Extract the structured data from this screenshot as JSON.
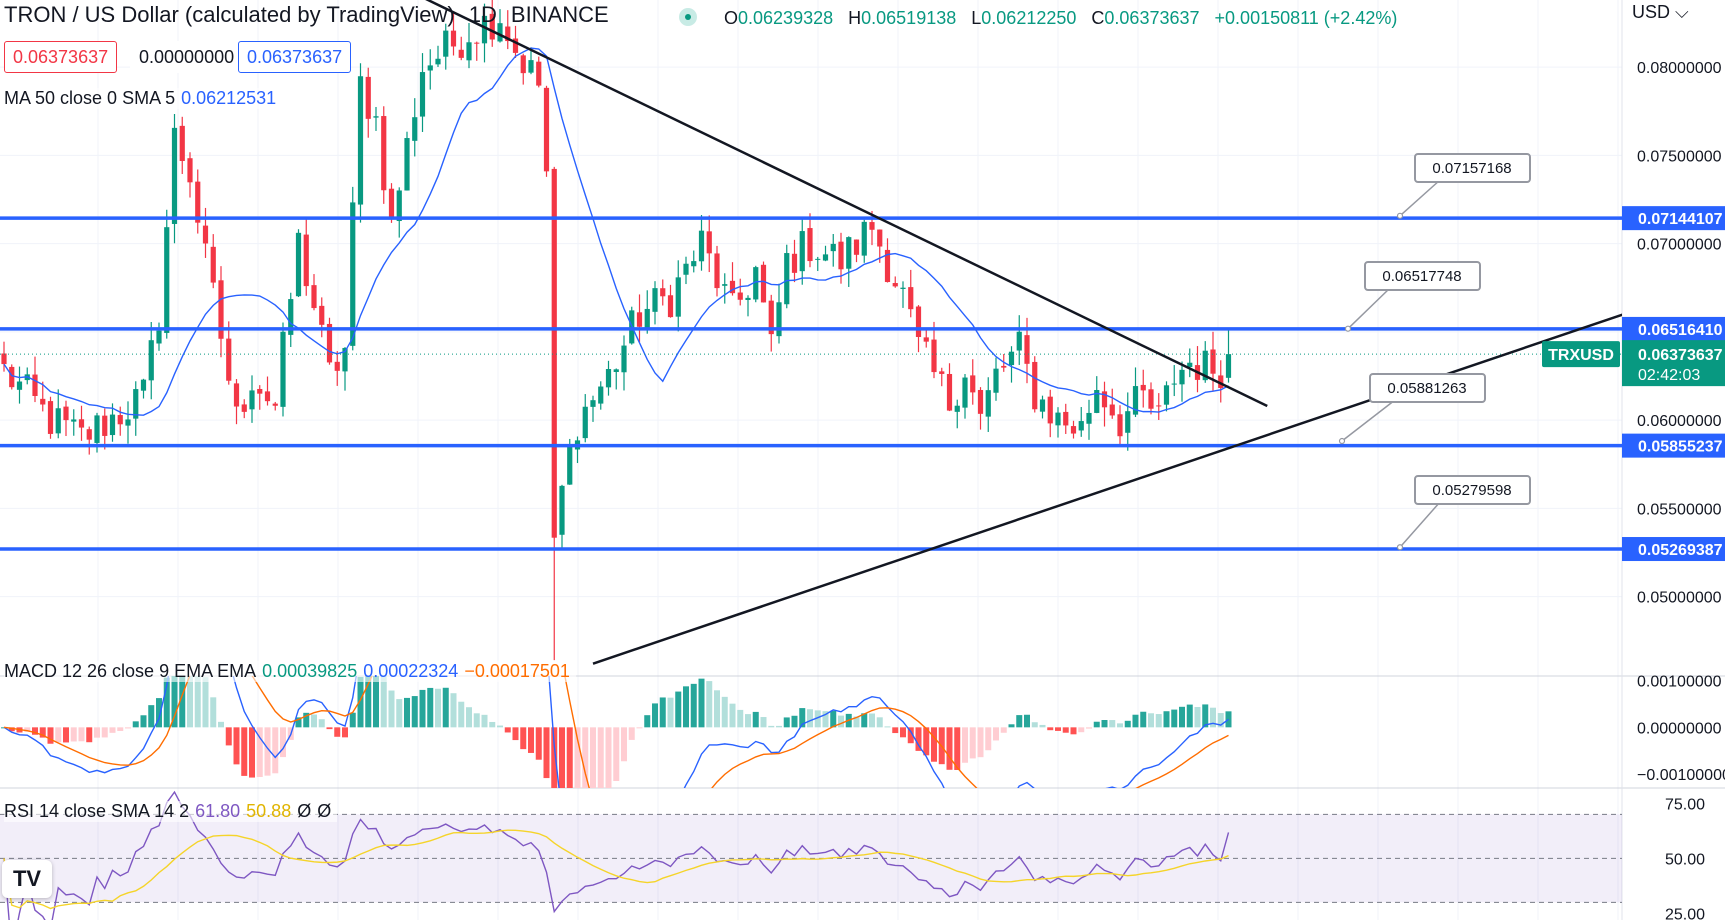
{
  "header": {
    "symbol_title": "TRON / US Dollar (calculated by TradingView)",
    "interval": "1D",
    "exchange": "BINANCE",
    "open_label": "O",
    "open": "0.06239328",
    "high_label": "H",
    "high": "0.06519138",
    "low_label": "L",
    "low": "0.06212250",
    "close_label": "C",
    "close": "0.06373637",
    "change": "+0.00150811 (+2.42%)"
  },
  "quote_boxes": {
    "sell": "0.06373637",
    "spread": "0.00000000",
    "buy": "0.06373637"
  },
  "currency_selector": "USD",
  "logo_text": "TV",
  "colors": {
    "up": "#089981",
    "down": "#f23645",
    "accent": "#2962ff",
    "ma_line": "#2962ff",
    "macd_line": "#2962ff",
    "signal_line": "#ff6d00",
    "rsi_line": "#7e57c2",
    "rsi_sma": "#f5d42a",
    "level_line": "#2962ff"
  },
  "indicators": {
    "ma": {
      "label": "MA 50 close 0 SMA 5",
      "value": "0.06212531"
    },
    "macd": {
      "label": "MACD 12 26 close 9 EMA EMA",
      "hist": "0.00039825",
      "macd": "0.00022324",
      "signal": "−0.00017501"
    },
    "rsi": {
      "label": "RSI 14 close SMA 14 2",
      "rsi": "61.80",
      "sma": "50.88",
      "extra1": "Ø",
      "extra2": "Ø"
    }
  },
  "chart_data": [
    {
      "type": "candlestick",
      "name": "TRXUSD",
      "ylim": [
        0.0455,
        0.0838
      ],
      "y_ticks": [
        "0.08000000",
        "0.07500000",
        "0.07000000",
        "0.06500000",
        "0.06000000",
        "0.05500000",
        "0.05000000"
      ],
      "y_tick_values": [
        0.08,
        0.075,
        0.07,
        0.065,
        0.06,
        0.055,
        0.05
      ],
      "price_badge": {
        "label": "TRXUSD",
        "price": "0.06373637",
        "countdown": "02:42:03",
        "value": 0.06373637
      },
      "horizontal_levels": [
        {
          "value": 0.07144107,
          "label": "0.07144107"
        },
        {
          "value": 0.0651641,
          "label": "0.06516410"
        },
        {
          "value": 0.05855237,
          "label": "0.05855237"
        },
        {
          "value": 0.05269387,
          "label": "0.05269387"
        }
      ],
      "callouts": [
        {
          "label": "0.07157168",
          "value": 0.07157168
        },
        {
          "label": "0.06517748",
          "value": 0.06517748
        },
        {
          "label": "0.05881263",
          "value": 0.05881263
        },
        {
          "label": "0.05279598",
          "value": 0.05279598
        }
      ],
      "trendlines": [
        {
          "name": "descending resistance",
          "from": [
            50,
            0.0848
          ],
          "to": [
            163,
            0.0608
          ]
        },
        {
          "name": "ascending support",
          "from": [
            76,
            0.0462
          ],
          "to": [
            209,
            0.066
          ]
        }
      ],
      "ma_series": "MA 50",
      "bars": 209
    },
    {
      "type": "bar",
      "name": "MACD",
      "ylim": [
        -0.0013,
        0.0011
      ],
      "y_ticks": [
        "0.00100000",
        "0.00000000",
        "−0.00100000"
      ],
      "y_tick_values": [
        0.001,
        0,
        -0.001
      ]
    },
    {
      "type": "line",
      "name": "RSI",
      "ylim": [
        22,
        82
      ],
      "y_ticks": [
        "75.00",
        "50.00",
        "25.00"
      ],
      "y_tick_values": [
        75,
        50,
        25
      ],
      "bands": [
        70,
        50,
        30
      ]
    }
  ]
}
